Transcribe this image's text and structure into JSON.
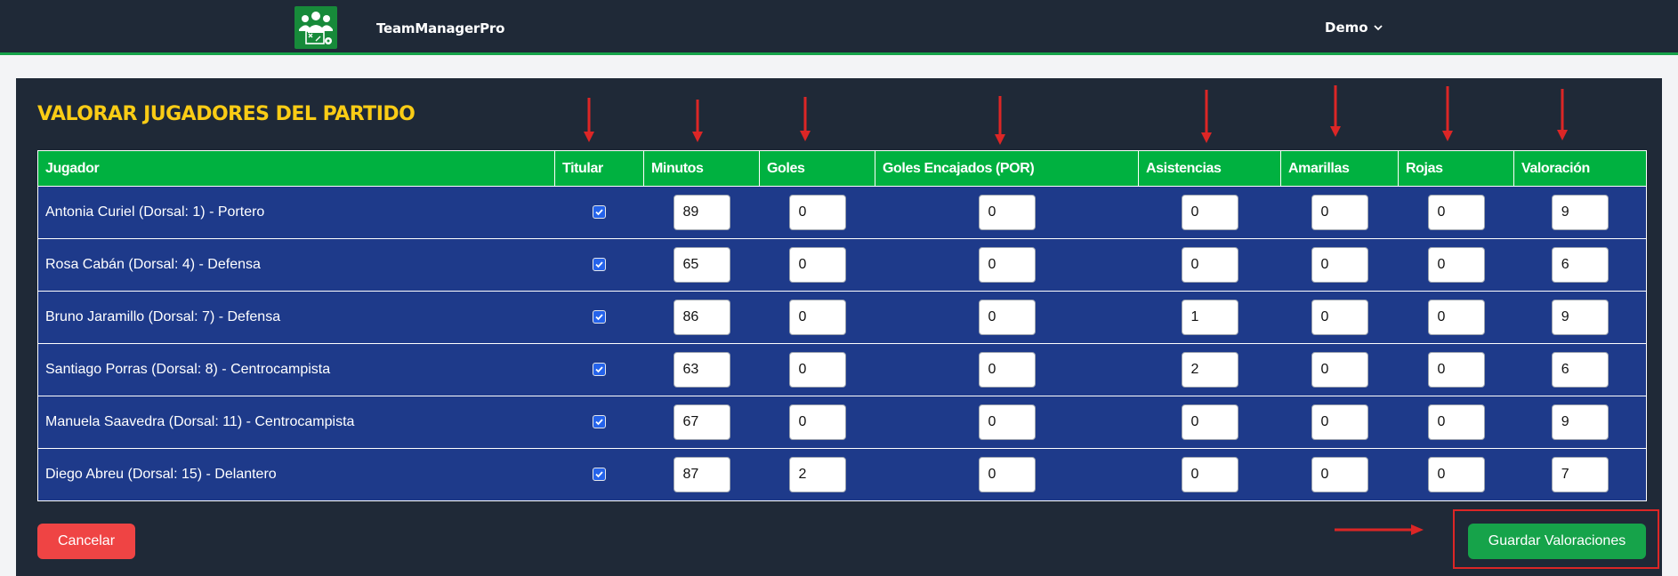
{
  "navbar": {
    "brand": "TeamManagerPro",
    "user": "Demo"
  },
  "page": {
    "title": "VALORAR JUGADORES DEL PARTIDO"
  },
  "table": {
    "headers": [
      "Jugador",
      "Titular",
      "Minutos",
      "Goles",
      "Goles Encajados (POR)",
      "Asistencias",
      "Amarillas",
      "Rojas",
      "Valoración"
    ],
    "rows": [
      {
        "player": "Antonia Curiel (Dorsal: 1) - Portero",
        "starter": true,
        "minutes": "89",
        "goals": "0",
        "goals_conceded": "0",
        "assists": "0",
        "yellow": "0",
        "red": "0",
        "rating": "9"
      },
      {
        "player": "Rosa Cabán (Dorsal: 4) - Defensa",
        "starter": true,
        "minutes": "65",
        "goals": "0",
        "goals_conceded": "0",
        "assists": "0",
        "yellow": "0",
        "red": "0",
        "rating": "6"
      },
      {
        "player": "Bruno Jaramillo (Dorsal: 7) - Defensa",
        "starter": true,
        "minutes": "86",
        "goals": "0",
        "goals_conceded": "0",
        "assists": "1",
        "yellow": "0",
        "red": "0",
        "rating": "9"
      },
      {
        "player": "Santiago Porras (Dorsal: 8) - Centrocampista",
        "starter": true,
        "minutes": "63",
        "goals": "0",
        "goals_conceded": "0",
        "assists": "2",
        "yellow": "0",
        "red": "0",
        "rating": "6"
      },
      {
        "player": "Manuela Saavedra (Dorsal: 11) - Centrocampista",
        "starter": true,
        "minutes": "67",
        "goals": "0",
        "goals_conceded": "0",
        "assists": "0",
        "yellow": "0",
        "red": "0",
        "rating": "9"
      },
      {
        "player": "Diego Abreu (Dorsal: 15) - Delantero",
        "starter": true,
        "minutes": "87",
        "goals": "2",
        "goals_conceded": "0",
        "assists": "0",
        "yellow": "0",
        "red": "0",
        "rating": "7"
      }
    ]
  },
  "actions": {
    "cancel": "Cancelar",
    "save": "Guardar Valoraciones"
  },
  "colors": {
    "navbar": "#1f2937",
    "accent_green": "#00b140",
    "row_blue": "#1e3a8a",
    "title_yellow": "#facc15",
    "cancel_red": "#ef4444",
    "annotation_red": "#dc2626"
  },
  "icons": {
    "logo": "team-logo-icon",
    "dropdown": "chevron-down-icon",
    "checkbox": "checkmark-icon",
    "annotation": "arrow-icon"
  }
}
